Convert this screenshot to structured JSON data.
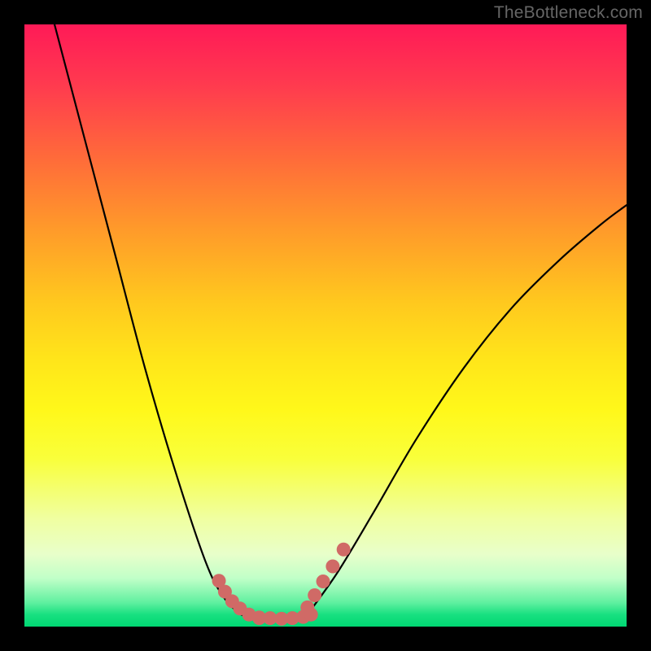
{
  "watermark": "TheBottleneck.com",
  "chart_data": {
    "type": "line",
    "title": "",
    "xlabel": "",
    "ylabel": "",
    "xlim": [
      0,
      1
    ],
    "ylim": [
      0,
      1
    ],
    "series": [
      {
        "name": "left-curve",
        "x": [
          0.05,
          0.1,
          0.15,
          0.2,
          0.25,
          0.3,
          0.33,
          0.36,
          0.39
        ],
        "y": [
          1.0,
          0.81,
          0.62,
          0.43,
          0.26,
          0.11,
          0.05,
          0.02,
          0.01
        ]
      },
      {
        "name": "right-curve",
        "x": [
          0.47,
          0.52,
          0.58,
          0.65,
          0.73,
          0.81,
          0.89,
          0.96,
          1.0
        ],
        "y": [
          0.02,
          0.09,
          0.19,
          0.31,
          0.43,
          0.53,
          0.61,
          0.67,
          0.7
        ]
      },
      {
        "name": "salmon-left-dots",
        "x": [
          0.323,
          0.333,
          0.345,
          0.358,
          0.373,
          0.39
        ],
        "y": [
          0.076,
          0.058,
          0.042,
          0.03,
          0.02,
          0.014
        ]
      },
      {
        "name": "salmon-floor-dots",
        "x": [
          0.39,
          0.408,
          0.427,
          0.445,
          0.463,
          0.476
        ],
        "y": [
          0.015,
          0.014,
          0.013,
          0.014,
          0.016,
          0.02
        ]
      },
      {
        "name": "salmon-right-dots",
        "x": [
          0.47,
          0.482,
          0.496,
          0.512,
          0.53
        ],
        "y": [
          0.032,
          0.052,
          0.075,
          0.1,
          0.128
        ]
      }
    ],
    "colors": {
      "curve": "#000000",
      "dots": "#d06a66",
      "bg_top": "#ff1a57",
      "bg_bottom": "#00d873",
      "frame": "#000000"
    }
  }
}
